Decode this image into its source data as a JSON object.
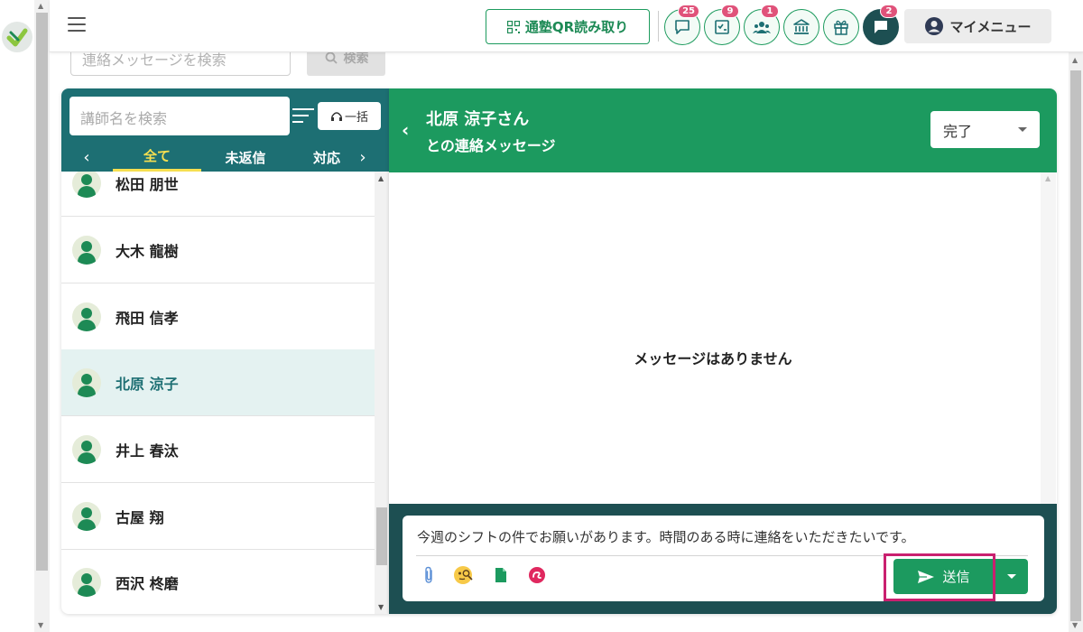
{
  "header": {
    "qr_button": "通塾QR読み取り",
    "my_menu": "マイメニュー",
    "icons": [
      {
        "name": "chat-bubble-icon",
        "badge": "25"
      },
      {
        "name": "checklist-icon",
        "badge": "9"
      },
      {
        "name": "group-icon",
        "badge": "1"
      },
      {
        "name": "bank-icon",
        "badge": ""
      },
      {
        "name": "gift-icon",
        "badge": ""
      },
      {
        "name": "message-icon",
        "badge": "2"
      }
    ]
  },
  "message_search": {
    "placeholder": "連絡メッセージを検索",
    "button": "検索"
  },
  "teacher_list": {
    "search_placeholder": "講師名を検索",
    "bulk_button": "一括",
    "tabs": [
      "全て",
      "未返信",
      "対応"
    ],
    "active_tab": "全て",
    "items": [
      "松田 朋世",
      "大木 龍樹",
      "飛田 信孝",
      "北原 涼子",
      "井上 春汰",
      "古屋 翔",
      "西沢 柊磨"
    ],
    "selected": "北原 涼子"
  },
  "conversation": {
    "title_line1": "北原 涼子さん",
    "title_line2": "との連絡メッセージ",
    "status": "完了",
    "empty_text": "メッセージはありません"
  },
  "composer": {
    "text": "今週のシフトの件でお願いがあります。時間のある時に連絡をいただきたいです。",
    "send_label": "送信"
  },
  "colors": {
    "primary_green": "#1c9a5f",
    "teal": "#1d6f73",
    "dark_teal": "#1d4f52",
    "badge_pink": "#e0527a",
    "highlight_magenta": "#c9206f",
    "tab_active_yellow": "#f6df50"
  }
}
